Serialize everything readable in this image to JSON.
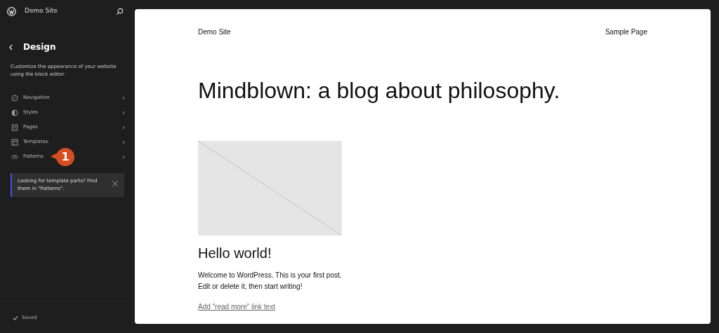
{
  "sidebar": {
    "site_title": "Demo Site",
    "heading": "Design",
    "description": "Customize the appearance of your website using the block editor.",
    "items": [
      {
        "label": "Navigation",
        "kind": "navigation"
      },
      {
        "label": "Styles",
        "kind": "styles"
      },
      {
        "label": "Pages",
        "kind": "pages"
      },
      {
        "label": "Templates",
        "kind": "templates"
      },
      {
        "label": "Patterns",
        "kind": "patterns"
      }
    ],
    "callout_badge": "1",
    "notice": "Looking for template parts? Find them in \"Patterns\".",
    "status": "Saved"
  },
  "preview": {
    "site_title": "Demo Site",
    "nav_link": "Sample Page",
    "heading": "Mindblown: a blog about philosophy.",
    "post_title": "Hello world!",
    "excerpt": "Welcome to WordPress. This is your first post. Edit or delete it, then start writing!",
    "read_more": "Add \"read more\" link text"
  }
}
